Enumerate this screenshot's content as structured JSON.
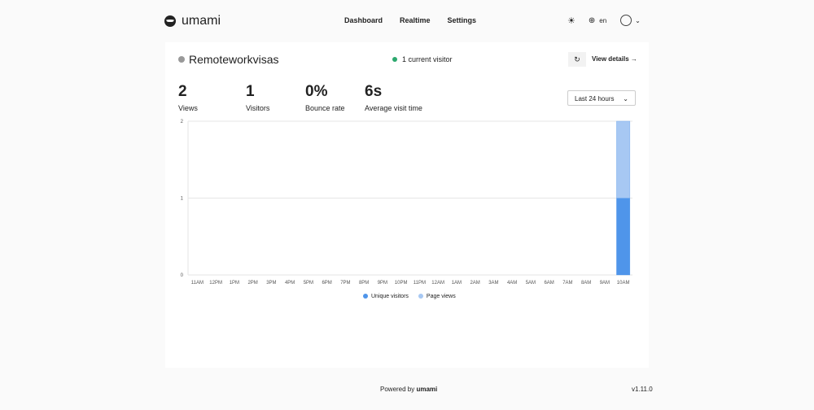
{
  "header": {
    "brand": "umami",
    "nav": [
      "Dashboard",
      "Realtime",
      "Settings"
    ],
    "lang": "en"
  },
  "site": {
    "name": "Remoteworkvisas",
    "current_visitors": "1 current visitor",
    "view_details": "View details"
  },
  "metrics": [
    {
      "value": "2",
      "label": "Views"
    },
    {
      "value": "1",
      "label": "Visitors"
    },
    {
      "value": "0%",
      "label": "Bounce rate"
    },
    {
      "value": "6s",
      "label": "Average visit time"
    }
  ],
  "range": "Last 24 hours",
  "colors": {
    "visitors": "#4f95ea",
    "pageviews": "#a7c8f3"
  },
  "chart_data": {
    "type": "bar",
    "categories": [
      "11AM",
      "12PM",
      "1PM",
      "2PM",
      "3PM",
      "4PM",
      "5PM",
      "6PM",
      "7PM",
      "8PM",
      "9PM",
      "10PM",
      "11PM",
      "12AM",
      "1AM",
      "2AM",
      "3AM",
      "4AM",
      "5AM",
      "6AM",
      "7AM",
      "8AM",
      "9AM",
      "10AM"
    ],
    "series": [
      {
        "name": "Unique visitors",
        "values": [
          0,
          0,
          0,
          0,
          0,
          0,
          0,
          0,
          0,
          0,
          0,
          0,
          0,
          0,
          0,
          0,
          0,
          0,
          0,
          0,
          0,
          0,
          0,
          1
        ]
      },
      {
        "name": "Page views",
        "values": [
          0,
          0,
          0,
          0,
          0,
          0,
          0,
          0,
          0,
          0,
          0,
          0,
          0,
          0,
          0,
          0,
          0,
          0,
          0,
          0,
          0,
          0,
          0,
          2
        ]
      }
    ],
    "yticks": [
      "0",
      "1",
      "2"
    ],
    "ylim": [
      0,
      2
    ],
    "legend": "bottom"
  },
  "footer": {
    "powered": "Powered by",
    "brand": "umami",
    "version": "v1.11.0"
  }
}
